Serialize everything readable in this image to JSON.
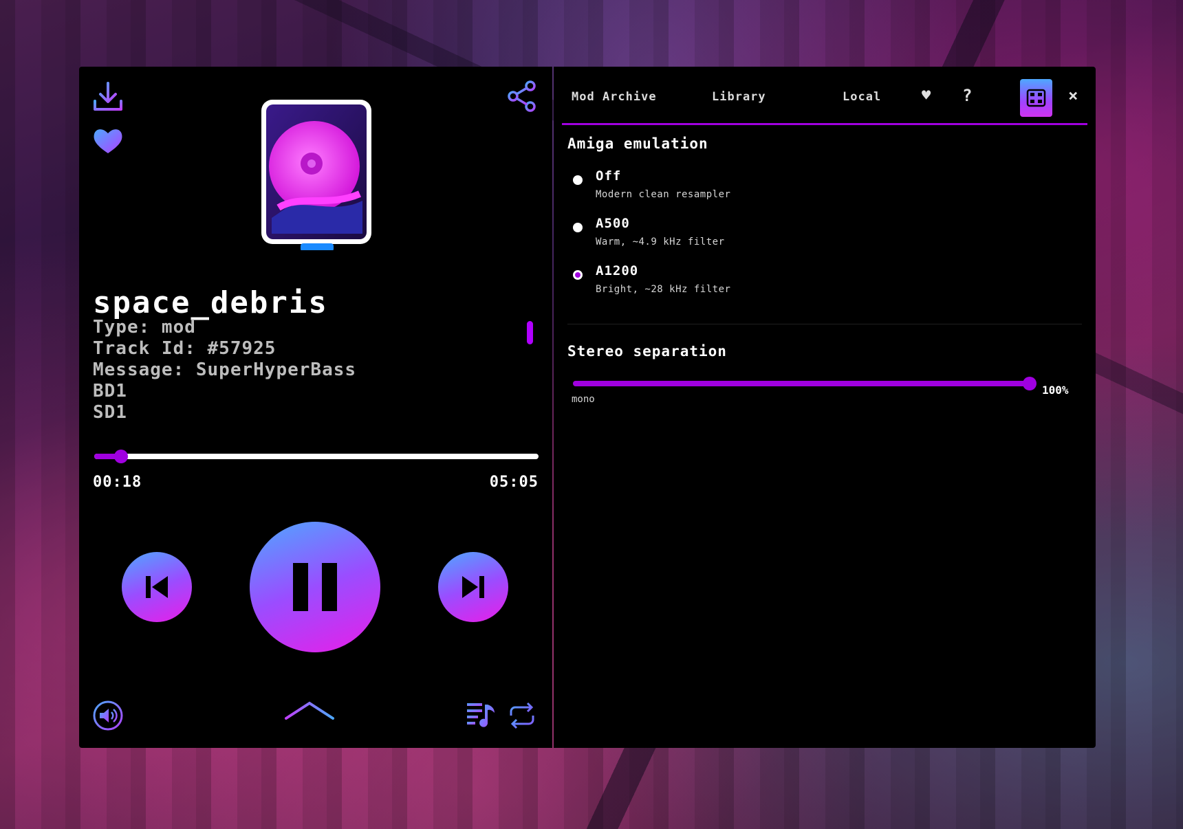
{
  "colors": {
    "accent": "#a000e0",
    "gradient_start": "#4ea8ff",
    "gradient_end": "#e81ee8"
  },
  "player": {
    "title": "space_debris",
    "meta_lines": [
      "Type: mod",
      "Track Id: #57925",
      "Message: SuperHyperBass",
      "BD1",
      "SD1"
    ],
    "elapsed": "00:18",
    "duration": "05:05",
    "progress": 0.06,
    "icons": {
      "download": "download-icon",
      "favorite": "heart-icon",
      "share": "share-icon",
      "prev": "skip-previous-icon",
      "pause": "pause-icon",
      "next": "skip-next-icon",
      "volume": "volume-icon",
      "expand": "chevron-up-icon",
      "playlist": "playlist-icon",
      "repeat": "repeat-icon",
      "cover": "hard-disk-icon"
    }
  },
  "settings": {
    "tabs": [
      "Mod Archive",
      "Library",
      "Local"
    ],
    "tab_icons": [
      "heart-icon",
      "help-icon",
      "settings-icon",
      "close-icon"
    ],
    "help_glyph": "?",
    "close_glyph": "×",
    "heart_glyph": "♥",
    "amiga": {
      "title": "Amiga emulation",
      "options": [
        {
          "label": "Off",
          "desc": "Modern clean resampler",
          "selected": false
        },
        {
          "label": "A500",
          "desc": "Warm, ~4.9 kHz filter",
          "selected": false
        },
        {
          "label": "A1200",
          "desc": "Bright, ~28 kHz filter",
          "selected": true
        }
      ]
    },
    "stereo": {
      "title": "Stereo separation",
      "value": 1.0,
      "value_label": "100%",
      "min_label": "mono"
    }
  }
}
